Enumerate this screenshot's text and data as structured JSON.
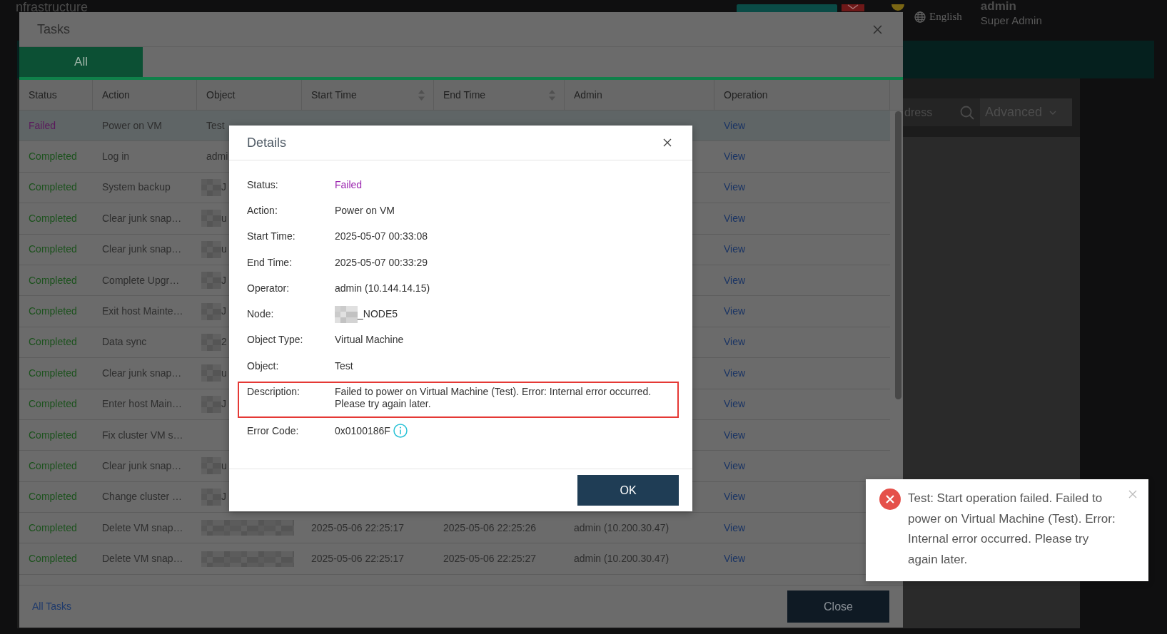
{
  "app": {
    "title": "nfrastructure",
    "language": "English",
    "user_name": "admin",
    "user_role": "Super Admin",
    "search": {
      "placeholder": "dress"
    },
    "advanced_button": "Advanced"
  },
  "tasks_dialog": {
    "title": "Tasks",
    "tabs": [
      {
        "label": "All",
        "selected": true
      }
    ],
    "columns": [
      {
        "label": "Status",
        "sortable": false
      },
      {
        "label": "Action",
        "sortable": false
      },
      {
        "label": "Object",
        "sortable": false
      },
      {
        "label": "Start Time",
        "sortable": true
      },
      {
        "label": "End Time",
        "sortable": true
      },
      {
        "label": "Admin",
        "sortable": false
      },
      {
        "label": "Operation",
        "sortable": false
      }
    ],
    "rows": [
      {
        "status": "Failed",
        "failed": true,
        "selected": true,
        "action": "Power on VM",
        "object": {
          "text": "Test",
          "redacted": false
        },
        "operation": "View"
      },
      {
        "status": "Completed",
        "failed": false,
        "selected": false,
        "action": "Log in",
        "object": {
          "text": "admi",
          "redacted": false
        },
        "operation": "View"
      },
      {
        "status": "Completed",
        "failed": false,
        "selected": false,
        "action": "System backup",
        "object": {
          "redacted": true,
          "text": "J"
        },
        "operation": "View"
      },
      {
        "status": "Completed",
        "failed": false,
        "selected": false,
        "action": "Clear junk snap…",
        "object": {
          "redacted": true,
          "text": "u"
        },
        "operation": "View"
      },
      {
        "status": "Completed",
        "failed": false,
        "selected": false,
        "action": "Clear junk snap…",
        "object": {
          "redacted": true,
          "text": "u"
        },
        "operation": "View"
      },
      {
        "status": "Completed",
        "failed": false,
        "selected": false,
        "action": "Complete Upgr…",
        "object": {
          "redacted": true,
          "text": "J"
        },
        "operation": "View"
      },
      {
        "status": "Completed",
        "failed": false,
        "selected": false,
        "action": "Exit host Mainte…",
        "object": {
          "redacted": true,
          "text": "J"
        },
        "operation": "View"
      },
      {
        "status": "Completed",
        "failed": false,
        "selected": false,
        "action": "Data sync",
        "object": {
          "redacted": true,
          "text": "2"
        },
        "operation": "View"
      },
      {
        "status": "Completed",
        "failed": false,
        "selected": false,
        "action": "Clear junk snap…",
        "object": {
          "redacted": true,
          "text": "u"
        },
        "operation": "View"
      },
      {
        "status": "Completed",
        "failed": false,
        "selected": false,
        "action": "Enter host Main…",
        "object": {
          "redacted": true,
          "text": "J"
        },
        "operation": "View"
      },
      {
        "status": "Completed",
        "failed": false,
        "selected": false,
        "action": "Fix cluster VM s…",
        "object": {
          "redacted": false
        },
        "operation": "View"
      },
      {
        "status": "Completed",
        "failed": false,
        "selected": false,
        "action": "Clear junk snap…",
        "object": {
          "redacted": true,
          "text": "u"
        },
        "operation": "View"
      },
      {
        "status": "Completed",
        "failed": false,
        "selected": false,
        "action": "Change cluster …",
        "object": {
          "redacted": true,
          "text": "J"
        },
        "operation": "View"
      },
      {
        "status": "Completed",
        "failed": false,
        "selected": false,
        "action": "Delete VM snap…",
        "object": {
          "redacted": true
        },
        "start_time": "2025-05-06 22:25:17",
        "end_time": "2025-05-06 22:25:26",
        "admin": "admin (10.200.30.47)",
        "operation": "View"
      },
      {
        "status": "Completed",
        "failed": false,
        "selected": false,
        "action": "Delete VM snap…",
        "object": {
          "redacted": true
        },
        "start_time": "2025-05-06 22:25:17",
        "end_time": "2025-05-06 22:25:27",
        "admin": "admin (10.200.30.47)",
        "operation": "View"
      }
    ],
    "footer_link": "All Tasks",
    "close_button": "Close"
  },
  "details_dialog": {
    "title": "Details",
    "fields": [
      {
        "label": "Status:",
        "value": "Failed",
        "kind": "status",
        "highlighted": false
      },
      {
        "label": "Action:",
        "value": "Power on VM",
        "kind": "text",
        "highlighted": false
      },
      {
        "label": "Start Time:",
        "value": "2025-05-07 00:33:08",
        "kind": "text",
        "highlighted": false
      },
      {
        "label": "End Time:",
        "value": "2025-05-07 00:33:29",
        "kind": "text",
        "highlighted": false
      },
      {
        "label": "Operator:",
        "value": "admin (10.144.14.15)",
        "kind": "text",
        "highlighted": false
      },
      {
        "label": "Node:",
        "value": "_NODE5",
        "kind": "redacted",
        "highlighted": false
      },
      {
        "label": "Object Type:",
        "value": "Virtual Machine",
        "kind": "text",
        "highlighted": false
      },
      {
        "label": "Object:",
        "value": "Test",
        "kind": "text",
        "highlighted": false
      },
      {
        "label": "Description:",
        "value": "Failed to power on Virtual Machine (Test). Error: Internal error occurred. Please try again later.",
        "kind": "text",
        "highlighted": true
      },
      {
        "label": "Error Code:",
        "value": "0x0100186F",
        "kind": "code",
        "highlighted": false
      }
    ],
    "ok_button": "OK"
  },
  "toast": {
    "kind": "error",
    "message": "Test: Start operation failed. Failed to power on Virtual Machine (Test). Error: Internal error occurred. Please try again later."
  }
}
